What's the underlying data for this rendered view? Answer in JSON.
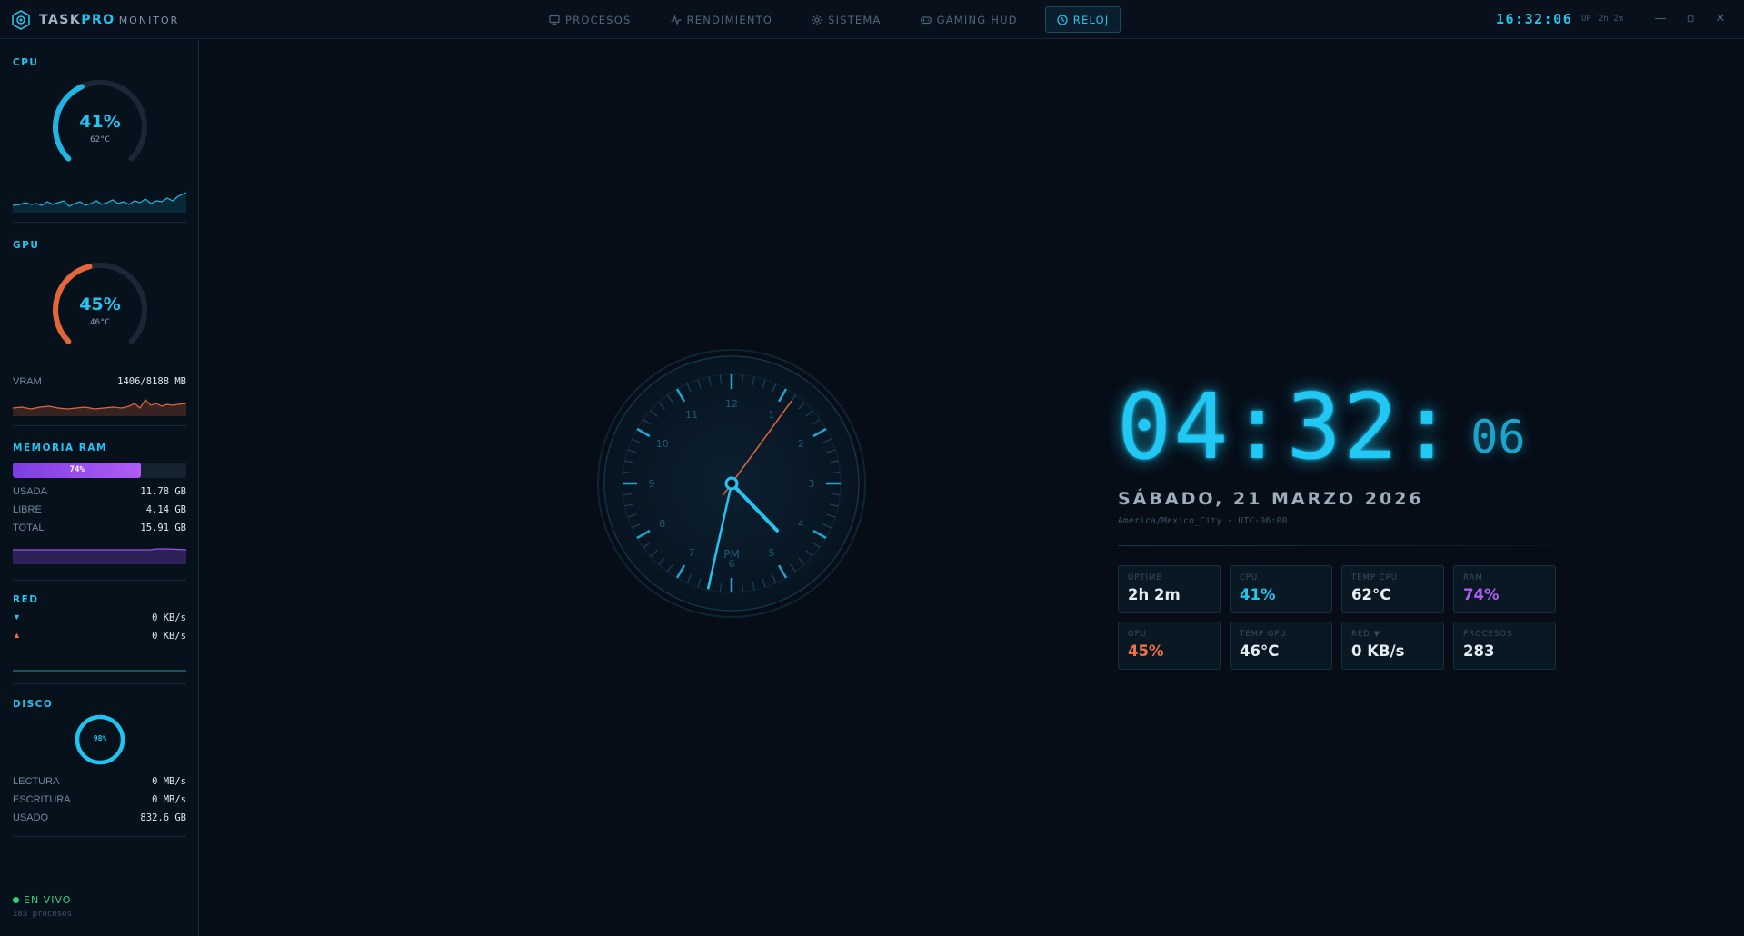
{
  "app": {
    "name_part1": "TASK",
    "name_part2": "PRO",
    "name_part3": "MONITOR"
  },
  "tabs": [
    {
      "label": "PROCESOS",
      "icon": "monitor-icon",
      "active": false
    },
    {
      "label": "RENDIMIENTO",
      "icon": "activity-icon",
      "active": false
    },
    {
      "label": "SISTEMA",
      "icon": "gear-icon",
      "active": false
    },
    {
      "label": "GAMING HUD",
      "icon": "gamepad-icon",
      "active": false
    },
    {
      "label": "RELOJ",
      "icon": "clock-icon",
      "active": true
    }
  ],
  "header": {
    "time": "16:32:06",
    "up_label": "UP",
    "uptime": "2h 2m",
    "minimize": "—",
    "maximize": "▫",
    "close": "✕"
  },
  "sidebar": {
    "cpu": {
      "title": "CPU",
      "percent": "41%",
      "percent_value": 41,
      "temp": "62°C"
    },
    "gpu": {
      "title": "GPU",
      "percent": "45%",
      "percent_value": 45,
      "temp": "46°C",
      "vram_label": "VRAM",
      "vram_value": "1406/8188 MB"
    },
    "ram": {
      "title": "MEMORIA RAM",
      "bar_label": "74%",
      "percent_value": 74,
      "rows": [
        {
          "label": "USADA",
          "value": "11.78 GB"
        },
        {
          "label": "LIBRE",
          "value": "4.14 GB"
        },
        {
          "label": "TOTAL",
          "value": "15.91 GB"
        }
      ]
    },
    "net": {
      "title": "RED",
      "down_icon": "▼",
      "down": "0 KB/s",
      "up_icon": "▲",
      "up": "0 KB/s"
    },
    "disk": {
      "title": "DISCO",
      "percent": "98%",
      "percent_value": 98,
      "rows": [
        {
          "label": "LECTURA",
          "value": "0 MB/s"
        },
        {
          "label": "ESCRITURA",
          "value": "0 MB/s"
        },
        {
          "label": "USADO",
          "value": "832.6 GB"
        }
      ]
    },
    "status": {
      "label": "EN VIVO",
      "processes": "283 procesos"
    }
  },
  "clock": {
    "hours_minutes": "04:32:",
    "seconds": "06",
    "meridiem": "PM",
    "date": "SÁBADO, 21 MARZO 2026",
    "timezone": "America/Mexico_City · UTC-06:00",
    "dial_numbers": [
      "12",
      "1",
      "2",
      "3",
      "4",
      "5",
      "6",
      "7",
      "8",
      "9",
      "10",
      "11"
    ],
    "hand_hours": 4,
    "hand_minutes": 32,
    "hand_seconds": 6
  },
  "stats": [
    {
      "label": "UPTIME",
      "value": "2h 2m",
      "color": "#e4eef4"
    },
    {
      "label": "CPU",
      "value": "41%",
      "color": "#22c4f0"
    },
    {
      "label": "TEMP CPU",
      "value": "62°C",
      "color": "#e4eef4"
    },
    {
      "label": "RAM",
      "value": "74%",
      "color": "#b05cf5"
    },
    {
      "label": "GPU",
      "value": "45%",
      "color": "#f07040"
    },
    {
      "label": "TEMP GPU",
      "value": "46°C",
      "color": "#e4eef4"
    },
    {
      "label": "RED ▼",
      "value": "0 KB/s",
      "color": "#e4eef4"
    },
    {
      "label": "PROCESOS",
      "value": "283",
      "color": "#e4eef4"
    }
  ],
  "colors": {
    "accent": "#22c4f0",
    "gpu": "#f07040",
    "ram": "#b05cf5",
    "live": "#33d17a",
    "background": "#060d17"
  }
}
